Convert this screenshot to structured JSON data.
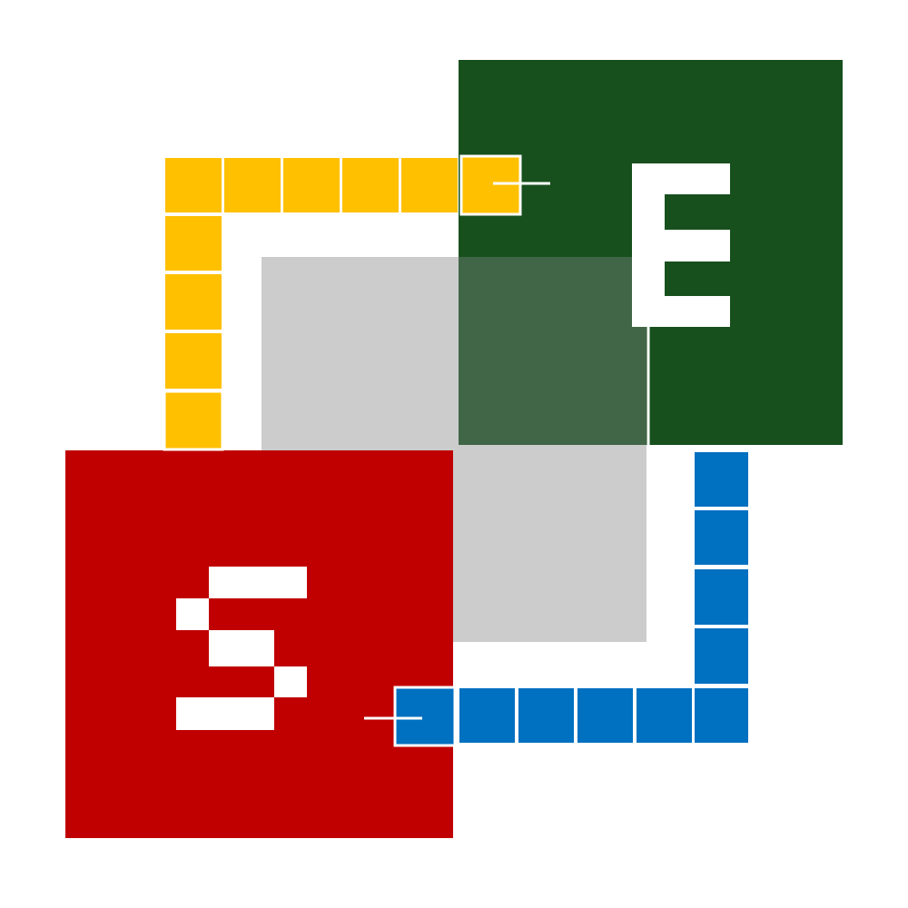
{
  "colors": {
    "background": "#ffffff",
    "start_block": "#c00000",
    "end_block": "#17501d",
    "overlap_zone": "#cccccc",
    "overlap_dark": "#416647",
    "path_yellow": "#ffc000",
    "path_blue": "#0070c0",
    "glyph": "#ffffff",
    "connector": "#ffffff"
  },
  "blocks": [
    {
      "id": "start",
      "letter": "S",
      "color_key": "start_block",
      "icon": "letter-s-glyph"
    },
    {
      "id": "end",
      "letter": "E",
      "color_key": "end_block",
      "icon": "letter-e-glyph"
    }
  ],
  "paths": [
    {
      "id": "yellow",
      "color_key": "path_yellow",
      "cell_count": 10
    },
    {
      "id": "blue",
      "color_key": "path_blue",
      "cell_count": 10
    }
  ]
}
